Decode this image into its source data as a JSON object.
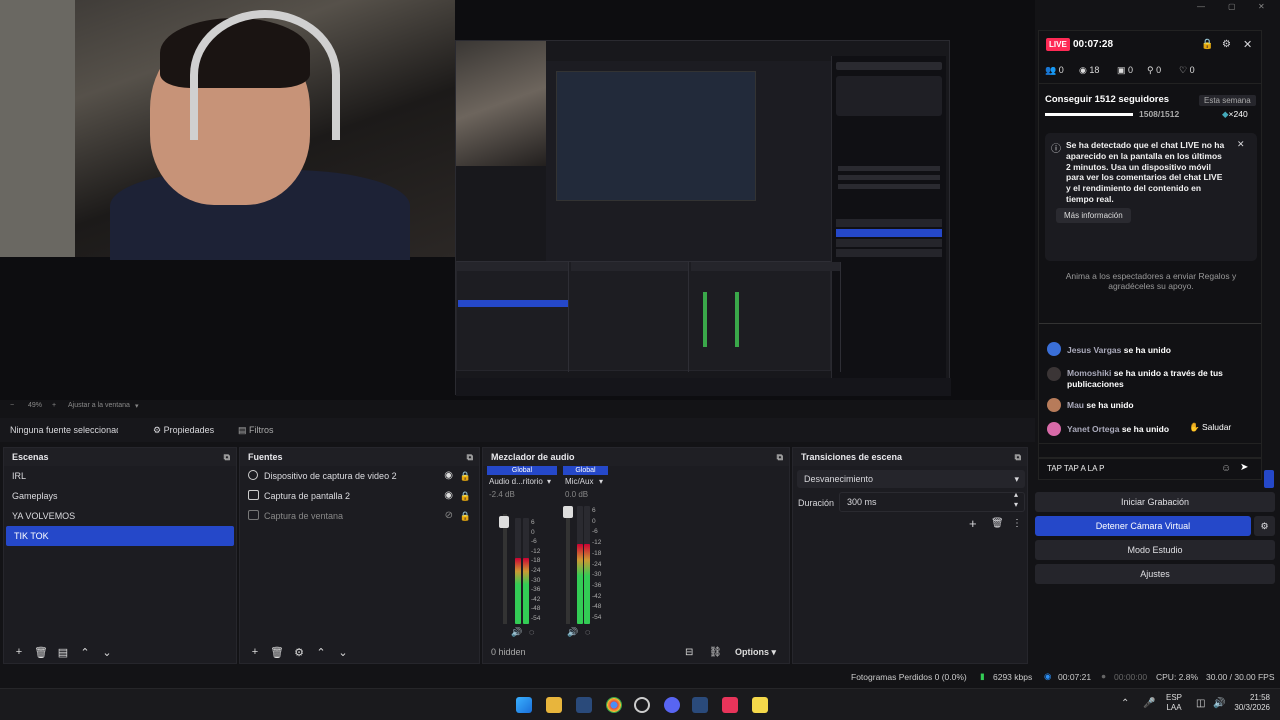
{
  "preview": {
    "zoom_label": "49%",
    "fit_label": "Ajustar a la ventana"
  },
  "properties_bar": {
    "no_source": "Ninguna fuente seleccionada",
    "properties": "Propiedades",
    "filters": "Filtros"
  },
  "scenes": {
    "title": "Escenas",
    "items": [
      "IRL",
      "Gameplays",
      "YA VOLVEMOS",
      "TIK TOK"
    ],
    "selected": "TIK TOK"
  },
  "sources": {
    "title": "Fuentes",
    "items": [
      {
        "label": "Dispositivo de captura de video 2",
        "visible": true
      },
      {
        "label": "Captura de pantalla 2",
        "visible": true
      },
      {
        "label": "Captura de ventana",
        "visible": false
      }
    ]
  },
  "mixer": {
    "title": "Mezclador de audio",
    "channels": [
      {
        "tag": "Global",
        "name": "Audio d...ritorio",
        "db": "-2.4 dB",
        "level": 0.62
      },
      {
        "tag": "Global",
        "name": "Mic/Aux",
        "db": "0.0 dB",
        "level": 0.68
      }
    ],
    "scale": [
      "6",
      "0",
      "-6",
      "-12",
      "-18",
      "-24",
      "-30",
      "-36",
      "-42",
      "-48",
      "-54"
    ],
    "hidden": "0 hidden",
    "options": "Options"
  },
  "transitions": {
    "title": "Transiciones de escena",
    "selected": "Desvanecimiento",
    "duration_label": "Duración",
    "duration_value": "300 ms"
  },
  "controls": {
    "record": "Iniciar Grabación",
    "virtual_cam": "Detener Cámara Virtual",
    "studio": "Modo Estudio",
    "settings": "Ajustes"
  },
  "tiktok": {
    "live": "LIVE",
    "timer": "00:07:28",
    "stats": [
      "0",
      "18",
      "0",
      "0",
      "0"
    ],
    "goal": "Conseguir 1512 seguidores",
    "goal_period": "Esta semana",
    "goal_progress": "1508/1512",
    "goal_fraction": 0.997,
    "goal_delta": "×240",
    "notice": "Se ha detectado que el chat LIVE no ha aparecido en la pantalla en los últimos 2 minutos. Usa un dispositivo móvil para ver los comentarios del chat LIVE y el rendimiento del contenido en tiempo real.",
    "more_info": "Más información",
    "encourage": "Anima a los espectadores a enviar Regalos y agradéceles su apoyo.",
    "chat": [
      {
        "user": "Jesus Vargas",
        "text": "se ha unido",
        "color": "#3a6fd8"
      },
      {
        "user": "Momoshiki",
        "text": "se ha unido a través de tus publicaciones",
        "color": "#3b3536"
      },
      {
        "user": "Mau",
        "text": "se ha unido",
        "color": "#b77b5a"
      },
      {
        "user": "Yanet Ortega",
        "text": "se ha unido",
        "color": "#d86aa8"
      }
    ],
    "greet": "Saludar",
    "input_text": "TAP TAP A LA P"
  },
  "status": {
    "dropped": "Fotogramas Perdidos 0 (0.0%)",
    "bitrate": "6293 kbps",
    "live_time": "00:07:21",
    "rec_time": "00:00:00",
    "cpu": "CPU: 2.8%",
    "fps": "30.00 / 30.00 FPS"
  },
  "tray": {
    "lang": "ESP",
    "lang2": "LAA",
    "time": "21:58",
    "date": "30/3/2026"
  }
}
